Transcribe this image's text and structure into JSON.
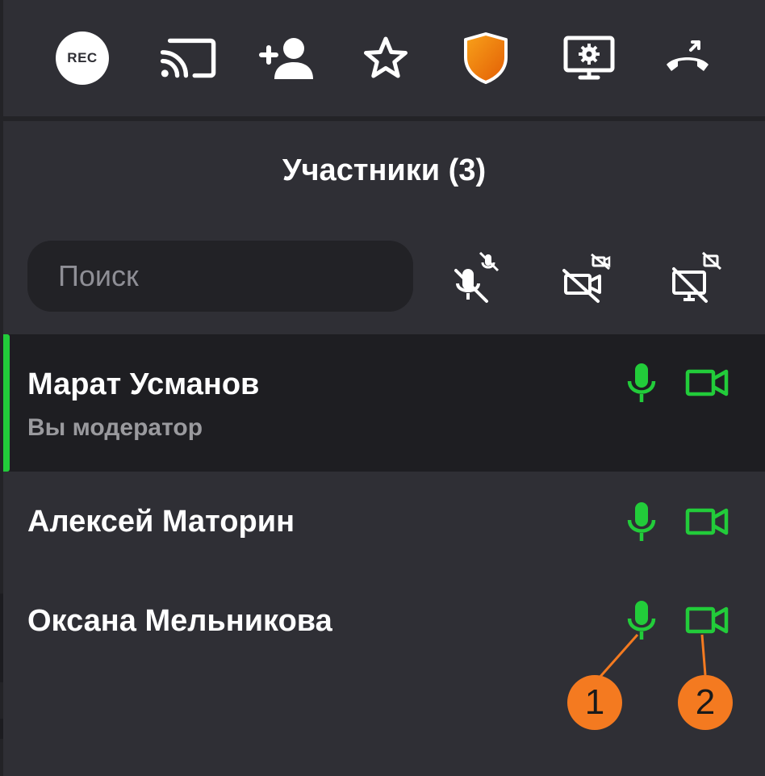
{
  "toolbar": {
    "rec_label": "REC",
    "icons": [
      "rec-icon",
      "cast-icon",
      "add-person-icon",
      "star-icon",
      "shield-icon",
      "screen-settings-icon",
      "hang-up-icon"
    ]
  },
  "panel": {
    "title": "Участники (3)"
  },
  "search": {
    "placeholder": "Поиск",
    "value": ""
  },
  "participants": [
    {
      "name": "Марат Усманов",
      "subtitle": "Вы модератор",
      "mic": "on",
      "camera": "on"
    },
    {
      "name": "Алексей Маторин",
      "mic": "on",
      "camera": "on"
    },
    {
      "name": "Оксана Мельникова",
      "mic": "on",
      "camera": "on"
    }
  ],
  "callouts": [
    "1",
    "2"
  ],
  "colors": {
    "background": "#2f2f35",
    "row_active": "#1e1e22",
    "accent_green": "#22cc3a",
    "callout_orange": "#f47a20",
    "shield_orange": "#f08a10"
  }
}
